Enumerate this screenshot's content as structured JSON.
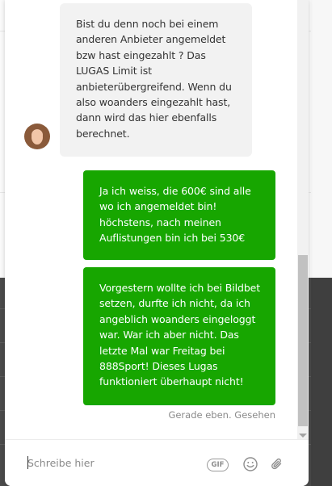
{
  "conversation": {
    "incoming_message": "Bist du denn noch bei einem anderen Anbieter angemeldet bzw hast eingezahlt ? Das LUGAS Limit ist anbieterübergreifend. Wenn du also woanders eingezahlt hast, dann wird das hier ebenfalls berechnet.",
    "outgoing_messages": [
      "Ja ich weiss, die 600€ sind alle wo ich angemeldet bin! höchstens, nach meinen Auflistungen bin ich bei 530€",
      "Vorgestern wollte ich bei Bildbet setzen, durfte ich nicht, da ich angeblich woanders eingeloggt war. War ich aber nicht. Das letzte Mal war Freitag bei 888Sport! Dieses Lugas funktioniert überhaupt nicht!"
    ],
    "status": "Gerade eben. Gesehen"
  },
  "composer": {
    "placeholder": "Schreibe hier",
    "gif_label": "GIF",
    "emoji_icon": "smiley-icon",
    "attach_icon": "paperclip-icon"
  },
  "colors": {
    "outgoing_bubble": "#17a600",
    "incoming_bubble": "#f2f2f2"
  }
}
